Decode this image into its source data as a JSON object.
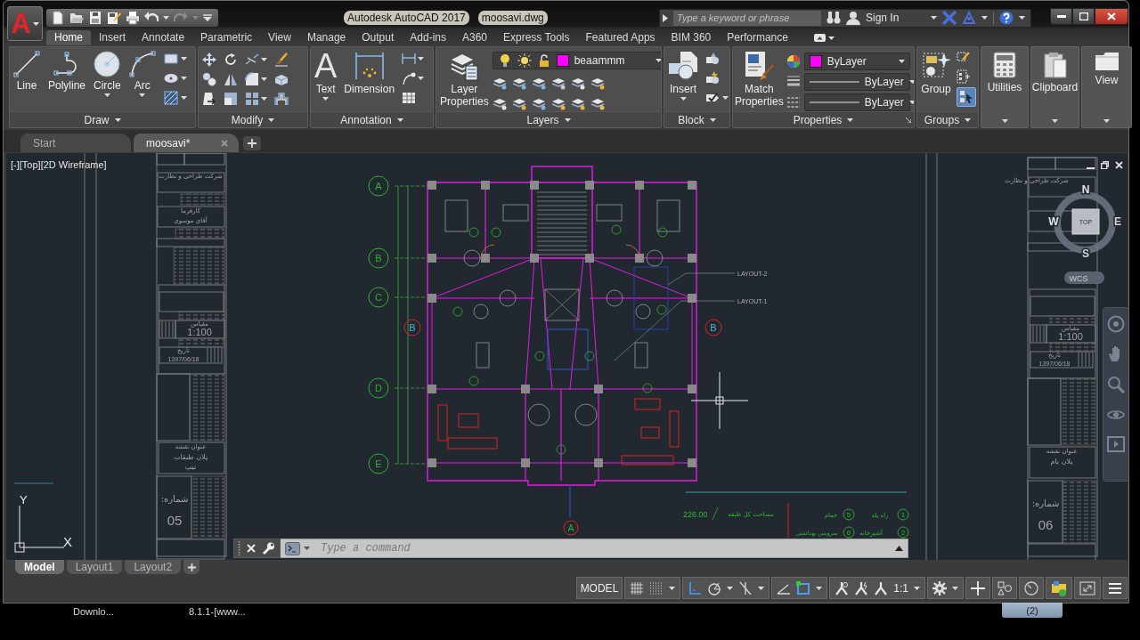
{
  "window": {
    "logo": "A",
    "title": "Autodesk AutoCAD 2017",
    "file": "moosavi.dwg"
  },
  "quick_access": {
    "undo_disabled": false,
    "redo_disabled": true
  },
  "search": {
    "placeholder": "Type a keyword or phrase"
  },
  "account": {
    "label": "Sign In"
  },
  "ribbon_tabs": [
    {
      "label": "Home",
      "selected": true
    },
    {
      "label": "Insert",
      "selected": false
    },
    {
      "label": "Annotate",
      "selected": false
    },
    {
      "label": "Parametric",
      "selected": false
    },
    {
      "label": "View",
      "selected": false
    },
    {
      "label": "Manage",
      "selected": false
    },
    {
      "label": "Output",
      "selected": false
    },
    {
      "label": "Add-ins",
      "selected": false
    },
    {
      "label": "A360",
      "selected": false
    },
    {
      "label": "Express Tools",
      "selected": false
    },
    {
      "label": "Featured Apps",
      "selected": false
    },
    {
      "label": "BIM 360",
      "selected": false
    },
    {
      "label": "Performance",
      "selected": false
    }
  ],
  "ribbon_panels": [
    {
      "kind": "draw",
      "title": "Draw",
      "menu": true,
      "tools": [
        {
          "label": "Line",
          "menu": false
        },
        {
          "label": "Polyline",
          "menu": false
        },
        {
          "label": "Circle",
          "menu": true
        },
        {
          "label": "Arc",
          "menu": true
        }
      ]
    },
    {
      "kind": "modify",
      "title": "Modify",
      "menu": true
    },
    {
      "kind": "annotation",
      "title": "Annotation",
      "menu": true,
      "tools": [
        {
          "label": "Text",
          "glyph": "A",
          "menu": true
        },
        {
          "label": "Dimension",
          "menu": false
        }
      ]
    },
    {
      "kind": "layers",
      "title": "Layers",
      "menu": true,
      "tools": [
        {
          "label": "Layer Properties",
          "menu": false
        }
      ],
      "layer": {
        "name": "beaammm",
        "color": "#ff00ff"
      }
    },
    {
      "kind": "block",
      "title": "Block",
      "menu": true,
      "tools": [
        {
          "label": "Insert",
          "menu": true
        }
      ]
    },
    {
      "kind": "properties",
      "title": "Properties",
      "menu": true,
      "tools": [
        {
          "label": "Match Properties",
          "menu": false
        }
      ],
      "properties": [
        {
          "kind": "color",
          "value": "ByLayer",
          "color": "#ff00ff"
        },
        {
          "kind": "lineweight",
          "value": "ByLayer"
        },
        {
          "kind": "linetype",
          "value": "ByLayer"
        }
      ]
    },
    {
      "kind": "groups",
      "title": "Groups",
      "menu": true,
      "tools": [
        {
          "label": "Group",
          "menu": false
        }
      ],
      "selection_on": true
    },
    {
      "kind": "utilities",
      "label": "Utilities"
    },
    {
      "kind": "clipboard",
      "label": "Clipboard"
    },
    {
      "kind": "view",
      "label": "View"
    }
  ],
  "file_tabs": [
    {
      "label": "Start",
      "selected": false,
      "closable": false
    },
    {
      "label": "moosavi*",
      "selected": true,
      "closable": true
    }
  ],
  "viewport": {
    "controls": [
      "[-]",
      "[Top]",
      "[2D Wireframe]"
    ]
  },
  "viewcube": {
    "north": "N",
    "west": "W",
    "east": "E",
    "south": "S",
    "face": "TOP",
    "ucs": "WCS"
  },
  "ucs_icon": {
    "y": "Y",
    "x": "X"
  },
  "drawing": {
    "grid_labels": [
      "A",
      "B",
      "C",
      "D",
      "E"
    ],
    "bottom_grid_label": "A",
    "section_marks": [
      "B",
      "B"
    ],
    "leaders": [
      "LAYOUT-2",
      "LAYOUT-1"
    ],
    "sheets": [
      {
        "company": "شرکت طراحی و نظارت",
        "client_label": "کارفرما",
        "client": "آقای موسوی",
        "scale_label": "مقیاس",
        "scale": "1:100",
        "date_label": "تاریخ",
        "date": "1397/06/18",
        "title_label": "عنوان نقشه",
        "title": [
          "پلان طبقات",
          "تیپ"
        ],
        "number_label": "شماره:",
        "number": "05"
      },
      {
        "company": "شرکت طراحی و نظارت",
        "scale_label": "مقیاس",
        "scale": "1:100",
        "date_label": "تاریخ",
        "date": "1397/06/18",
        "title_label": "عنوان نقشه",
        "title": [
          "پلان بام"
        ],
        "number_label": "شماره:",
        "number": "06"
      }
    ],
    "legend": {
      "area_label": "مساحت کل طبقه",
      "area": "226.00",
      "columns": [
        {
          "items": [
            {
              "number": "1",
              "label": "راه پله"
            },
            {
              "number": "2",
              "label": "آشپزخانه"
            }
          ]
        },
        {
          "items": [
            {
              "number": "5",
              "label": "حمام"
            },
            {
              "number": "6",
              "label": "سرویس بهداشتی"
            }
          ]
        }
      ]
    }
  },
  "command_line": {
    "placeholder": "Type a command"
  },
  "layout_tabs": [
    {
      "label": "Model",
      "selected": true
    },
    {
      "label": "Layout1",
      "selected": false
    },
    {
      "label": "Layout2",
      "selected": false
    }
  ],
  "status_bar": {
    "space": "MODEL",
    "groups": [
      {
        "tools": [
          {
            "kind": "grid",
            "on": false,
            "menu": false
          },
          {
            "kind": "snap",
            "on": false,
            "menu": true
          }
        ]
      },
      {
        "tools": [
          {
            "kind": "ortho",
            "on": true,
            "menu": false
          },
          {
            "kind": "polar",
            "on": false,
            "menu": true
          },
          {
            "kind": "isodraft",
            "on": false,
            "menu": true
          }
        ]
      },
      {
        "tools": [
          {
            "kind": "otrack",
            "on": false,
            "menu": false
          },
          {
            "kind": "osnap",
            "on": true,
            "menu": true
          }
        ]
      },
      {
        "tools": [
          {
            "kind": "annovis",
            "menu": false
          },
          {
            "kind": "autoscale",
            "menu": false
          },
          {
            "kind": "annoscale",
            "menu": false
          },
          {
            "kind": "scale",
            "label": "1:1",
            "menu": true
          }
        ]
      },
      {
        "tools": [
          {
            "kind": "workspace",
            "menu": true
          }
        ]
      },
      {
        "tools": [
          {
            "kind": "plus",
            "menu": false
          }
        ]
      },
      {
        "tools": [
          {
            "kind": "isolate",
            "menu": false
          }
        ]
      },
      {
        "tools": [
          {
            "kind": "clock",
            "menu": false
          }
        ]
      },
      {
        "tools": [
          {
            "kind": "hardware",
            "menu": false
          }
        ]
      },
      {
        "tools": [
          {
            "kind": "fullscreen",
            "menu": false
          }
        ]
      },
      {
        "tools": [
          {
            "kind": "customize",
            "menu": false
          }
        ]
      }
    ]
  },
  "taskbar": {
    "items": [
      "Downlo...",
      "8.1.1-[www..."
    ],
    "button": "(2)"
  }
}
